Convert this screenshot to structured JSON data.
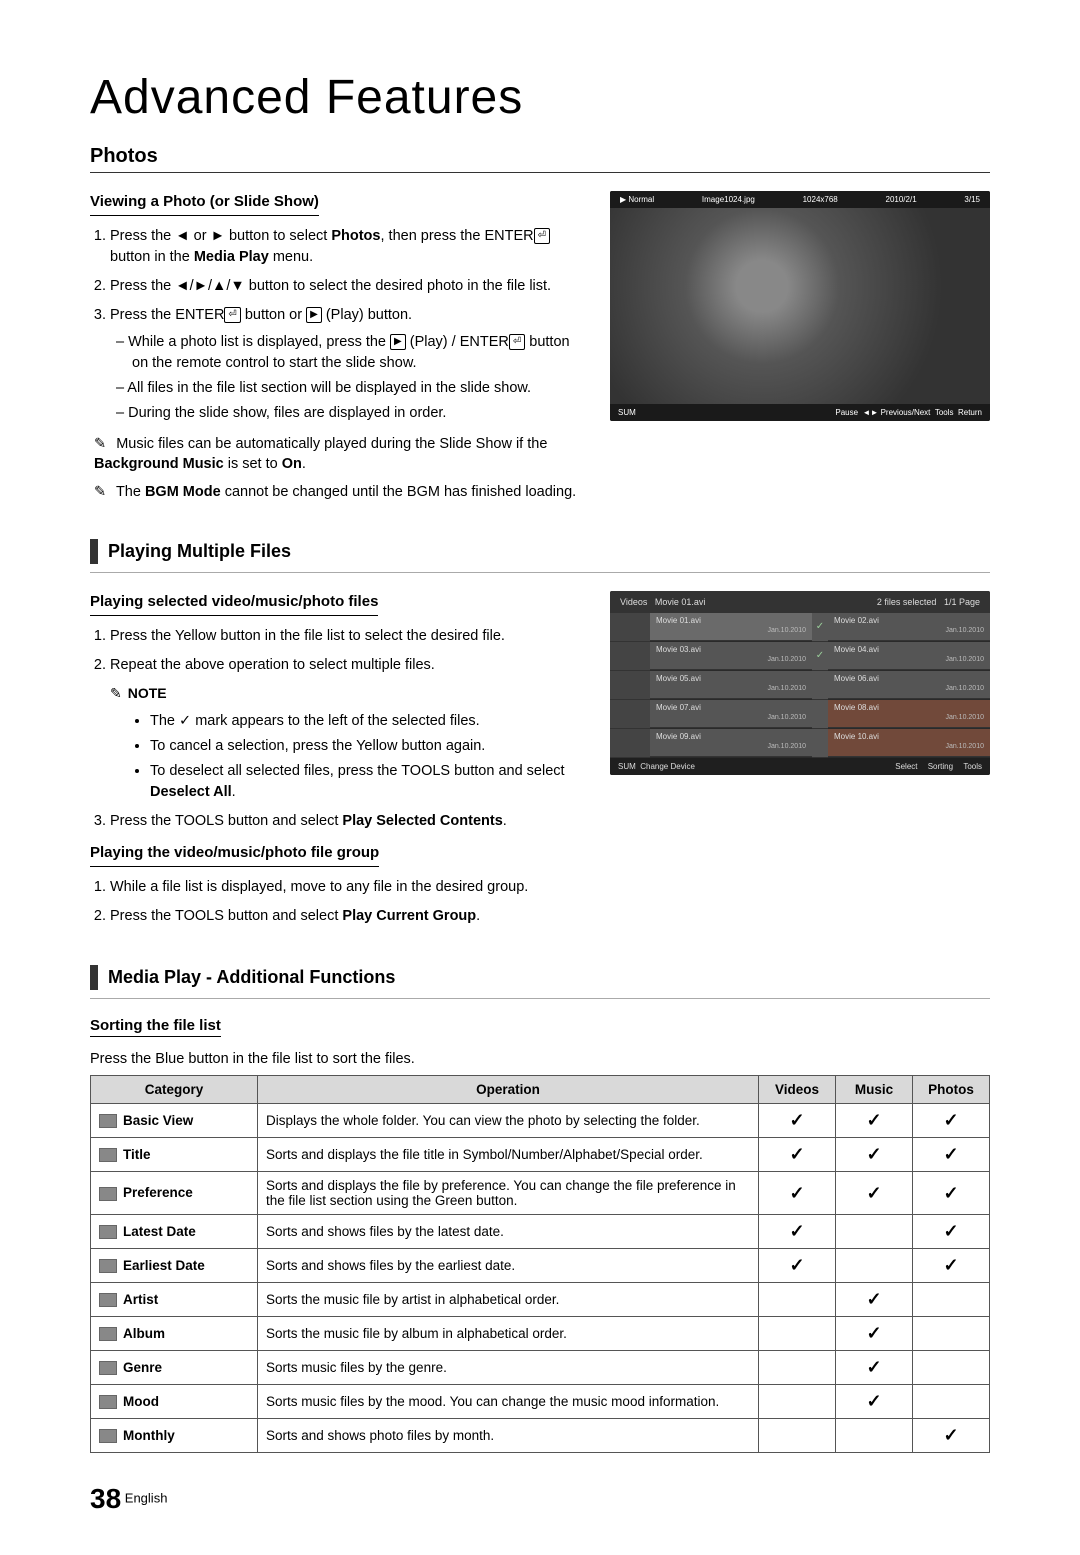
{
  "title": "Advanced Features",
  "photos": {
    "heading": "Photos",
    "sub1": "Viewing a Photo (or Slide Show)",
    "step1_a": "Press the ◄ or ► button to select ",
    "step1_b": "Photos",
    "step1_c": ", then press the ENTER",
    "step1_d": " button in the ",
    "step1_e": "Media Play",
    "step1_f": " menu.",
    "step2": "Press the ◄/►/▲/▼ button to select the desired photo in the file list.",
    "step3_a": "Press the ENTER",
    "step3_b": " button or ",
    "step3_c": " (Play) button.",
    "d1_a": "While a photo list is displayed, press the ",
    "d1_b": " (Play) / ENTER",
    "d1_c": " button on the remote control to start the slide show.",
    "d2": "All files in the file list section will be displayed in the slide show.",
    "d3": "During the slide show, files are displayed in order.",
    "note1_a": "Music files can be automatically played during the Slide Show if the ",
    "note1_b": "Background Music",
    "note1_c": " is set to ",
    "note1_d": "On",
    "note1_e": ".",
    "note2_a": "The ",
    "note2_b": "BGM Mode",
    "note2_c": " cannot be changed until the BGM has finished loading."
  },
  "photo_preview": {
    "mode": "▶ Normal",
    "file": "Image1024.jpg",
    "res": "1024x768",
    "date": "2010/2/1",
    "pos": "3/15",
    "sum": "SUM",
    "f1": "Pause",
    "f2": "◄► Previous/Next",
    "f3": "Tools",
    "f4": "Return"
  },
  "multi": {
    "heading": "Playing Multiple Files",
    "sub1": "Playing selected video/music/photo files",
    "s1": "Press the Yellow button in the file list to select the desired file.",
    "s2": "Repeat the above operation to select multiple files.",
    "note_label": "NOTE",
    "b1": "The ✓ mark appears to the left of the selected files.",
    "b2": "To cancel a selection, press the Yellow button again.",
    "b3_a": "To deselect all selected files, press the TOOLS button and select ",
    "b3_b": "Deselect All",
    "b3_c": ".",
    "s3_a": "Press the TOOLS button and select ",
    "s3_b": "Play Selected Contents",
    "s3_c": ".",
    "sub2": "Playing the video/music/photo file group",
    "g1": "While a file list is displayed, move to any file in the desired group.",
    "g2_a": "Press the TOOLS button and select ",
    "g2_b": "Play Current Group",
    "g2_c": "."
  },
  "video_preview": {
    "cat": "Videos",
    "current": "Movie 01.avi",
    "selinfo": "2 files selected",
    "page": "1/1 Page",
    "rows": [
      {
        "l": "Movie 01.avi",
        "ld": "Jan.10.2010",
        "r": "Movie 02.avi",
        "rd": "Jan.10.2010",
        "sel": true
      },
      {
        "l": "Movie 03.avi",
        "ld": "Jan.10.2010",
        "r": "Movie 04.avi",
        "rd": "Jan.10.2010",
        "sel": true
      },
      {
        "l": "Movie 05.avi",
        "ld": "Jan.10.2010",
        "r": "Movie 06.avi",
        "rd": "Jan.10.2010",
        "sel": false
      },
      {
        "l": "Movie 07.avi",
        "ld": "Jan.10.2010",
        "r": "Movie 08.avi",
        "rd": "Jan.10.2010",
        "sel": false
      },
      {
        "l": "Movie 09.avi",
        "ld": "Jan.10.2010",
        "r": "Movie 10.avi",
        "rd": "Jan.10.2010",
        "sel": false
      }
    ],
    "sum": "SUM",
    "change": "Change Device",
    "f1": "Select",
    "f2": "Sorting",
    "f3": "Tools"
  },
  "additional": {
    "heading": "Media Play - Additional Functions",
    "sub": "Sorting the file list",
    "desc": "Press the Blue button in the file list to sort the files."
  },
  "table": {
    "headers": {
      "cat": "Category",
      "op": "Operation",
      "v": "Videos",
      "m": "Music",
      "p": "Photos"
    },
    "rows": [
      {
        "cat": "Basic View",
        "op": "Displays the whole folder. You can view the photo by selecting the folder.",
        "v": true,
        "m": true,
        "p": true
      },
      {
        "cat": "Title",
        "op": "Sorts and displays the file title in Symbol/Number/Alphabet/Special order.",
        "v": true,
        "m": true,
        "p": true
      },
      {
        "cat": "Preference",
        "op": "Sorts and displays the file by preference. You can change the file preference in the file list section using the Green button.",
        "v": true,
        "m": true,
        "p": true
      },
      {
        "cat": "Latest Date",
        "op": "Sorts and shows files by the latest date.",
        "v": true,
        "m": false,
        "p": true
      },
      {
        "cat": "Earliest Date",
        "op": "Sorts and shows files by the earliest date.",
        "v": true,
        "m": false,
        "p": true
      },
      {
        "cat": "Artist",
        "op": "Sorts the music file by artist in alphabetical order.",
        "v": false,
        "m": true,
        "p": false
      },
      {
        "cat": "Album",
        "op": "Sorts the music file by album in alphabetical order.",
        "v": false,
        "m": true,
        "p": false
      },
      {
        "cat": "Genre",
        "op": "Sorts music files by the genre.",
        "v": false,
        "m": true,
        "p": false
      },
      {
        "cat": "Mood",
        "op": "Sorts music files by the mood. You can change the music mood information.",
        "v": false,
        "m": true,
        "p": false
      },
      {
        "cat": "Monthly",
        "op": "Sorts and shows photo files by month.",
        "v": false,
        "m": false,
        "p": true
      }
    ]
  },
  "footer": {
    "page": "38",
    "lang": "English"
  }
}
